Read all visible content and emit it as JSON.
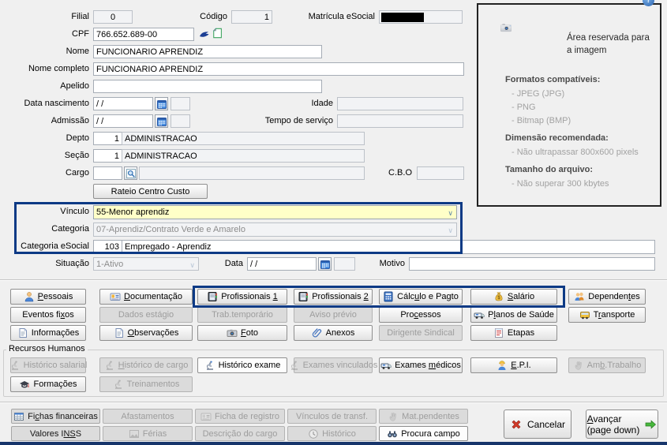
{
  "colors": {
    "accent_navy": "#0d3a85",
    "highlight_yellow": "#ffffc8",
    "window_bg": "#f0f0f0",
    "panel_border": "#222222",
    "bottom_bar": "#17356b"
  },
  "form": {
    "filial": {
      "label": "Filial",
      "value": "0"
    },
    "codigo": {
      "label": "Código",
      "value": "1"
    },
    "matricula": {
      "label": "Matrícula eSocial",
      "value_redacted": true
    },
    "cpf": {
      "label": "CPF",
      "value": "766.652.689-00"
    },
    "nome": {
      "label": "Nome",
      "value": "FUNCIONARIO APRENDIZ"
    },
    "nome_completo": {
      "label": "Nome completo",
      "value": "FUNCIONARIO APRENDIZ"
    },
    "apelido": {
      "label": "Apelido",
      "value": ""
    },
    "data_nascimento": {
      "label": "Data nascimento",
      "value": "/  /"
    },
    "idade": {
      "label": "Idade",
      "value": ""
    },
    "admissao": {
      "label": "Admissão",
      "value": "/  /"
    },
    "tempo_servico": {
      "label": "Tempo de serviço",
      "value": ""
    },
    "depto": {
      "label": "Depto",
      "code": "1",
      "desc": "ADMINISTRACAO"
    },
    "secao": {
      "label": "Seção",
      "code": "1",
      "desc": "ADMINISTRACAO"
    },
    "cargo": {
      "label": "Cargo",
      "code": "",
      "desc": ""
    },
    "cbo": {
      "label": "C.B.O",
      "value": ""
    },
    "rateio": {
      "label": "Rateio Centro Custo",
      "state": "normal"
    },
    "vinculo": {
      "label": "Vínculo",
      "value": "55-Menor aprendiz"
    },
    "categoria": {
      "label": "Categoria",
      "value": "07-Aprendiz/Contrato Verde e Amarelo"
    },
    "categoria_esocial": {
      "label": "Categoria eSocial",
      "code": "103",
      "desc": "Empregado - Aprendiz"
    },
    "situacao": {
      "label": "Situação",
      "value": "1-Ativo"
    },
    "data_situacao": {
      "label": "Data",
      "value": "/  /"
    },
    "motivo": {
      "label": "Motivo",
      "value": ""
    }
  },
  "image_panel": {
    "reserved_text": "Área reservada para a imagem",
    "sections": [
      {
        "heading": "Formatos compatíveis:",
        "items": [
          "- JPEG (JPG)",
          "- PNG",
          "- Bitmap (BMP)"
        ]
      },
      {
        "heading": "Dimensão recomendada:",
        "items": [
          "- Não ultrapassar 800x600 pixels"
        ]
      },
      {
        "heading": "Tamanho do arquivo:",
        "items": [
          "- Não superar 300 kbytes"
        ]
      }
    ],
    "icons": [
      "camera-icon",
      "help-icon"
    ]
  },
  "tabs": {
    "rows": [
      [
        {
          "label": "Pessoais",
          "u": [
            0,
            1
          ],
          "icon": "person",
          "state": "normal"
        },
        {
          "label": "Documentação",
          "u": [
            0,
            1
          ],
          "icon": "id-card",
          "state": "normal"
        },
        {
          "label": "Profissionais 1",
          "u": [
            14,
            1
          ],
          "icon": "address-book",
          "state": "normal"
        },
        {
          "label": "Profissionais 2",
          "u": [
            14,
            1
          ],
          "icon": "address-book",
          "state": "normal"
        },
        {
          "label": "Cálculo e Pagto",
          "u": [
            4,
            1
          ],
          "icon": "calculator",
          "state": "normal"
        },
        {
          "label": "Salário",
          "u": [
            0,
            1
          ],
          "icon": "money-bag",
          "state": "normal"
        },
        {
          "label": "Dependentes",
          "u": [
            8,
            1
          ],
          "icon": "people",
          "state": "normal"
        }
      ],
      [
        {
          "label": "Eventos fixos",
          "u": [
            10,
            1
          ],
          "state": "normal"
        },
        {
          "label": "Dados estágio",
          "u": [
            10,
            1
          ],
          "state": "disabled"
        },
        {
          "label": "Trab.temporário",
          "state": "disabled"
        },
        {
          "label": "Aviso prévio",
          "state": "disabled"
        },
        {
          "label": "Processos",
          "u": [
            3,
            1
          ],
          "state": "normal"
        },
        {
          "label": "Planos de Saúde",
          "u": [
            1,
            1
          ],
          "icon": "ambulance",
          "state": "normal"
        },
        {
          "label": "Transporte",
          "u": [
            1,
            1
          ],
          "icon": "bus",
          "state": "normal"
        }
      ],
      [
        {
          "label": "Informações",
          "icon": "document",
          "state": "normal"
        },
        {
          "label": "Observações",
          "u": [
            0,
            1
          ],
          "icon": "document",
          "state": "normal"
        },
        {
          "label": "Foto",
          "u": [
            0,
            1
          ],
          "icon": "camera-small",
          "state": "normal"
        },
        {
          "label": "Anexos",
          "icon": "paperclip",
          "state": "normal"
        },
        {
          "label": "Dirigente Sindical",
          "state": "disabled"
        },
        {
          "label": "Etapas",
          "icon": "notepad",
          "state": "normal"
        }
      ]
    ]
  },
  "rh": {
    "legend": "Recursos Humanos",
    "rows": [
      [
        {
          "label": "Histórico salarial",
          "icon": "microscope",
          "state": "disabled"
        },
        {
          "label": "Histórico de cargo",
          "u": [
            0,
            1
          ],
          "icon": "microscope",
          "state": "disabled"
        },
        {
          "label": "Histórico exame",
          "icon": "microscope",
          "state": "white"
        },
        {
          "label": "Exames vinculados",
          "icon": "microscope",
          "state": "disabled"
        },
        {
          "label": "Exames médicos",
          "u": [
            7,
            1
          ],
          "icon": "ambulance",
          "state": "normal"
        },
        {
          "label": "E.P.I.",
          "u": [
            0,
            1
          ],
          "icon": "worker",
          "state": "normal"
        },
        {
          "label": "Amb.Trabalho",
          "u": [
            2,
            1
          ],
          "icon": "hand",
          "state": "disabled"
        }
      ],
      [
        {
          "label": "Formações",
          "icon": "grad-cap",
          "state": "normal"
        },
        {
          "label": "Treinamentos",
          "icon": "microscope",
          "state": "disabled"
        }
      ]
    ]
  },
  "footer_tools": {
    "rows": [
      [
        {
          "label": "Fichas financeiras",
          "u": [
            2,
            1
          ],
          "icon": "table",
          "state": "flat"
        },
        {
          "label": "Afastamentos",
          "state": "disabled"
        },
        {
          "label": "Ficha de registro",
          "icon": "id-card",
          "state": "disabled"
        },
        {
          "label": "Vínculos de transf.",
          "state": "disabled"
        },
        {
          "label": "Mat.pendentes",
          "icon": "hand",
          "state": "disabled"
        }
      ],
      [
        {
          "label": "Valores INSS",
          "u": [
            9,
            2
          ],
          "state": "flat"
        },
        {
          "label": "Férias",
          "icon": "image",
          "state": "disabled"
        },
        {
          "label": "Descrição do cargo",
          "state": "disabled"
        },
        {
          "label": "Histórico",
          "icon": "clock",
          "state": "disabled"
        },
        {
          "label": "Procura campo",
          "icon": "binoculars",
          "state": "white"
        }
      ]
    ]
  },
  "actions": {
    "cancel": {
      "label": "Cancelar",
      "icon": "red-x",
      "state": "normal"
    },
    "advance": {
      "label": "Avançar",
      "label2": "(page down)",
      "u": [
        0,
        1
      ],
      "icon": "green-arrow",
      "icon_right": true,
      "state": "normal"
    }
  }
}
